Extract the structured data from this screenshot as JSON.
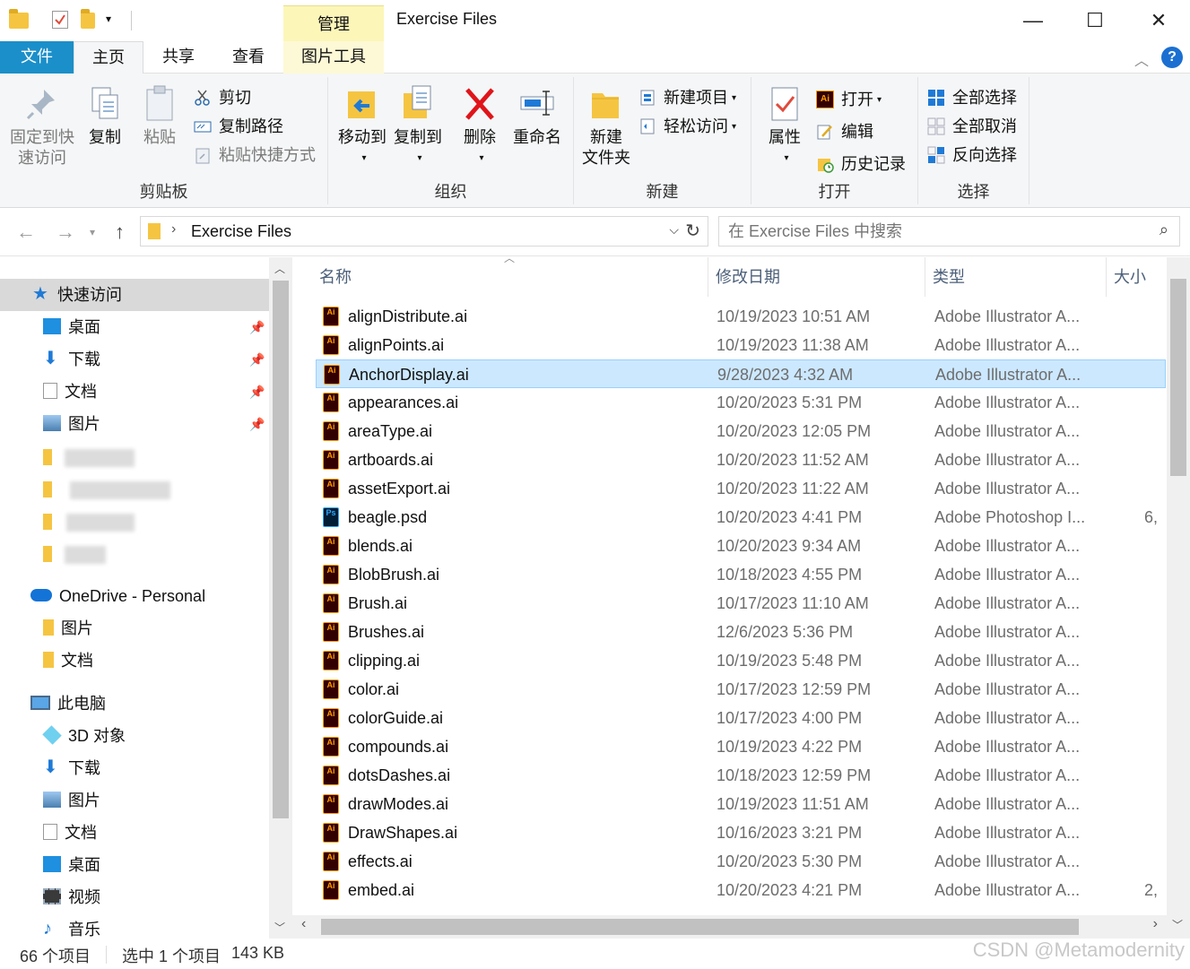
{
  "titlebar": {
    "manage_tab": "管理",
    "title": "Exercise Files",
    "minimize": "—",
    "maximize": "☐",
    "close": "✕"
  },
  "tabs": {
    "file": "文件",
    "home": "主页",
    "share": "共享",
    "view": "查看",
    "picture_tools": "图片工具",
    "help": "?"
  },
  "ribbon": {
    "clipboard": {
      "label": "剪贴板",
      "pin": "固定到快\n速访问",
      "pin_line1": "固定到快",
      "pin_line2": "速访问",
      "copy": "复制",
      "paste": "粘贴",
      "cut": "剪切",
      "copy_path": "复制路径",
      "paste_shortcut": "粘贴快捷方式"
    },
    "organize": {
      "label": "组织",
      "move_to": "移动到",
      "copy_to": "复制到",
      "delete": "删除",
      "rename": "重命名"
    },
    "new": {
      "label": "新建",
      "new_folder_line1": "新建",
      "new_folder_line2": "文件夹",
      "new_item": "新建项目",
      "easy_access": "轻松访问"
    },
    "open": {
      "label": "打开",
      "properties": "属性",
      "open": "打开",
      "edit": "编辑",
      "history": "历史记录"
    },
    "select": {
      "label": "选择",
      "select_all": "全部选择",
      "select_none": "全部取消",
      "invert": "反向选择"
    }
  },
  "address": {
    "path": "Exercise Files",
    "search_placeholder": "在 Exercise Files 中搜索"
  },
  "nav": {
    "quick_access": "快速访问",
    "qa_items": [
      "桌面",
      "下载",
      "文档",
      "图片"
    ],
    "onedrive": "OneDrive - Personal",
    "onedrive_items": [
      "图片",
      "文档"
    ],
    "this_pc": "此电脑",
    "pc_items": [
      "3D 对象",
      "下载",
      "图片",
      "文档",
      "桌面",
      "视频",
      "音乐"
    ]
  },
  "columns": {
    "name": "名称",
    "modified": "修改日期",
    "type": "类型",
    "size": "大小"
  },
  "files": [
    {
      "name": "alignDistribute.ai",
      "date": "10/19/2023 10:51 AM",
      "type": "Adobe Illustrator A...",
      "size": "",
      "kind": "ai"
    },
    {
      "name": "alignPoints.ai",
      "date": "10/19/2023 11:38 AM",
      "type": "Adobe Illustrator A...",
      "size": "",
      "kind": "ai"
    },
    {
      "name": "AnchorDisplay.ai",
      "date": "9/28/2023 4:32 AM",
      "type": "Adobe Illustrator A...",
      "size": "",
      "kind": "ai"
    },
    {
      "name": "appearances.ai",
      "date": "10/20/2023 5:31 PM",
      "type": "Adobe Illustrator A...",
      "size": "",
      "kind": "ai"
    },
    {
      "name": "areaType.ai",
      "date": "10/20/2023 12:05 PM",
      "type": "Adobe Illustrator A...",
      "size": "",
      "kind": "ai"
    },
    {
      "name": "artboards.ai",
      "date": "10/20/2023 11:52 AM",
      "type": "Adobe Illustrator A...",
      "size": "",
      "kind": "ai"
    },
    {
      "name": "assetExport.ai",
      "date": "10/20/2023 11:22 AM",
      "type": "Adobe Illustrator A...",
      "size": "",
      "kind": "ai"
    },
    {
      "name": "beagle.psd",
      "date": "10/20/2023 4:41 PM",
      "type": "Adobe Photoshop I...",
      "size": "6,",
      "kind": "ps"
    },
    {
      "name": "blends.ai",
      "date": "10/20/2023 9:34 AM",
      "type": "Adobe Illustrator A...",
      "size": "",
      "kind": "ai"
    },
    {
      "name": "BlobBrush.ai",
      "date": "10/18/2023 4:55 PM",
      "type": "Adobe Illustrator A...",
      "size": "",
      "kind": "ai"
    },
    {
      "name": "Brush.ai",
      "date": "10/17/2023 11:10 AM",
      "type": "Adobe Illustrator A...",
      "size": "",
      "kind": "ai"
    },
    {
      "name": "Brushes.ai",
      "date": "12/6/2023 5:36 PM",
      "type": "Adobe Illustrator A...",
      "size": "",
      "kind": "ai"
    },
    {
      "name": "clipping.ai",
      "date": "10/19/2023 5:48 PM",
      "type": "Adobe Illustrator A...",
      "size": "",
      "kind": "ai"
    },
    {
      "name": "color.ai",
      "date": "10/17/2023 12:59 PM",
      "type": "Adobe Illustrator A...",
      "size": "",
      "kind": "ai"
    },
    {
      "name": "colorGuide.ai",
      "date": "10/17/2023 4:00 PM",
      "type": "Adobe Illustrator A...",
      "size": "",
      "kind": "ai"
    },
    {
      "name": "compounds.ai",
      "date": "10/19/2023 4:22 PM",
      "type": "Adobe Illustrator A...",
      "size": "",
      "kind": "ai"
    },
    {
      "name": "dotsDashes.ai",
      "date": "10/18/2023 12:59 PM",
      "type": "Adobe Illustrator A...",
      "size": "",
      "kind": "ai"
    },
    {
      "name": "drawModes.ai",
      "date": "10/19/2023 11:51 AM",
      "type": "Adobe Illustrator A...",
      "size": "",
      "kind": "ai"
    },
    {
      "name": "DrawShapes.ai",
      "date": "10/16/2023 3:21 PM",
      "type": "Adobe Illustrator A...",
      "size": "",
      "kind": "ai"
    },
    {
      "name": "effects.ai",
      "date": "10/20/2023 5:30 PM",
      "type": "Adobe Illustrator A...",
      "size": "",
      "kind": "ai"
    },
    {
      "name": "embed.ai",
      "date": "10/20/2023 4:21 PM",
      "type": "Adobe Illustrator A...",
      "size": "2,",
      "kind": "ai"
    }
  ],
  "selected_file": "AnchorDisplay.ai",
  "status": {
    "count": "66 个项目",
    "selection": "选中 1 个项目",
    "size": "143 KB"
  },
  "watermark": "CSDN @Metamodernity",
  "icons": {
    "ai_badge": "Ai",
    "ps_badge": "Ps"
  },
  "colors": {
    "accent": "#1b8fc9",
    "selection": "#cce8ff",
    "picture_tools": "#fcf6b9"
  }
}
